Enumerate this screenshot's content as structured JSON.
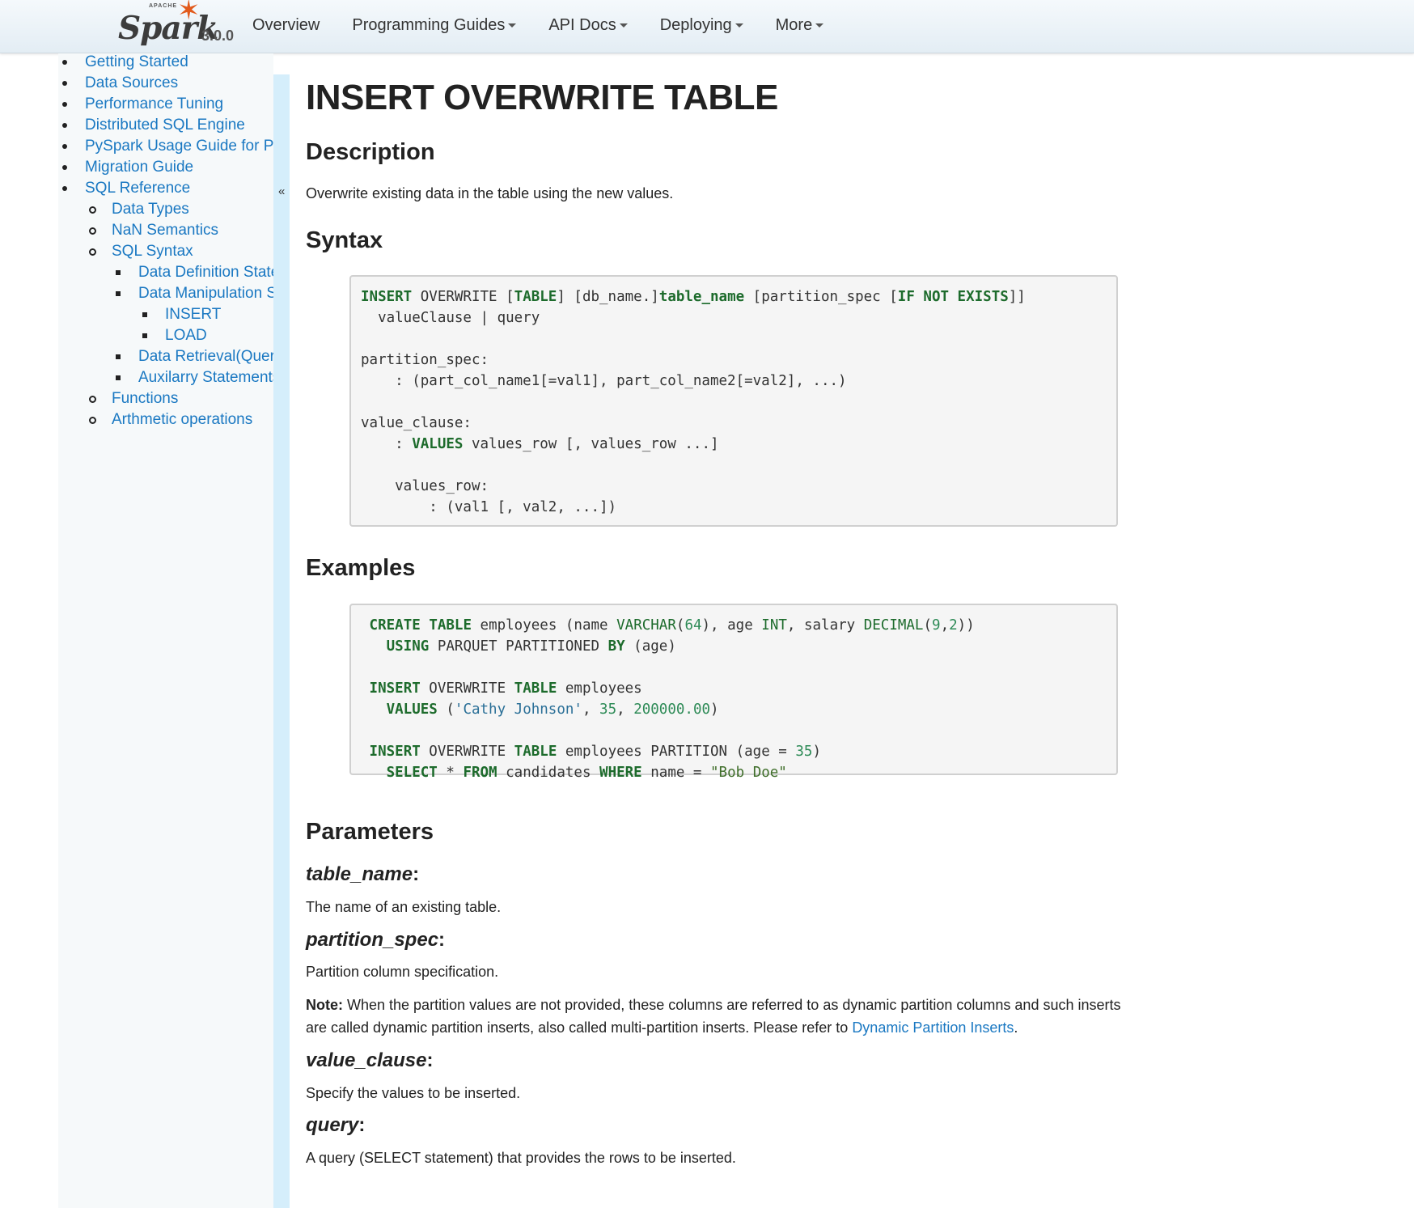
{
  "navbar": {
    "logo_apache": "APACHE",
    "logo_text": "Spark",
    "version": "3.0.0",
    "links": [
      {
        "label": "Overview",
        "dropdown": false
      },
      {
        "label": "Programming Guides",
        "dropdown": true
      },
      {
        "label": "API Docs",
        "dropdown": true
      },
      {
        "label": "Deploying",
        "dropdown": true
      },
      {
        "label": "More",
        "dropdown": true
      }
    ]
  },
  "sidebar": {
    "collapse_toggle": "«",
    "items": [
      {
        "label": "Getting Started",
        "level": 1
      },
      {
        "label": "Data Sources",
        "level": 1
      },
      {
        "label": "Performance Tuning",
        "level": 1
      },
      {
        "label": "Distributed SQL Engine",
        "level": 1
      },
      {
        "label": "PySpark Usage Guide for Pa",
        "level": 1
      },
      {
        "label": "Migration Guide",
        "level": 1
      },
      {
        "label": "SQL Reference",
        "level": 1
      },
      {
        "label": "Data Types",
        "level": 2
      },
      {
        "label": "NaN Semantics",
        "level": 2
      },
      {
        "label": "SQL Syntax",
        "level": 2
      },
      {
        "label": "Data Definition State",
        "level": 3
      },
      {
        "label": "Data Manipulation S",
        "level": 3
      },
      {
        "label": "INSERT",
        "level": 4
      },
      {
        "label": "LOAD",
        "level": 4
      },
      {
        "label": "Data Retrieval(Queri",
        "level": 3
      },
      {
        "label": "Auxilarry Statements",
        "level": 3
      },
      {
        "label": "Functions",
        "level": 2
      },
      {
        "label": "Arthmetic operations",
        "level": 2
      }
    ]
  },
  "main": {
    "title": "INSERT OVERWRITE TABLE",
    "description_heading": "Description",
    "description_text": "Overwrite existing data in the table using the new values.",
    "syntax_heading": "Syntax",
    "examples_heading": "Examples",
    "parameters_heading": "Parameters",
    "params": [
      {
        "name": "table_name",
        "desc": "The name of an existing table."
      },
      {
        "name": "partition_spec",
        "desc": "Partition column specification."
      },
      {
        "name": "value_clause",
        "desc": "Specify the values to be inserted."
      },
      {
        "name": "query",
        "desc": "A query (SELECT statement) that provides the rows to be inserted."
      }
    ],
    "note": {
      "label": "Note:",
      "text_1": " When the partition values are not provided, these columns are referred to as dynamic partition columns and such inserts",
      "text_2": "are called dynamic partition inserts, also called multi-partition inserts. Please refer to ",
      "link": "Dynamic Partition Inserts",
      "end": "."
    },
    "syntax_code": "INSERT OVERWRITE [TABLE] [db_name.]table_name [partition_spec [IF NOT EXISTS]]\n  valueClause | query\n\npartition_spec:\n    : (part_col_name1[=val1], part_col_name2[=val2], ...)\n\nvalue_clause:\n    : VALUES values_row [, values_row ...]\n\n    values_row:\n        : (val1 [, val2, ...])",
    "example_code": " CREATE TABLE employees (name VARCHAR(64), age INT, salary DECIMAL(9,2))\n   USING PARQUET PARTITIONED BY (age)\n\n INSERT OVERWRITE TABLE employees\n   VALUES ('Cathy Johnson', 35, 200000.00)\n\n INSERT OVERWRITE TABLE employees PARTITION (age = 35)\n   SELECT * FROM candidates WHERE name = \"Bob Doe\""
  }
}
